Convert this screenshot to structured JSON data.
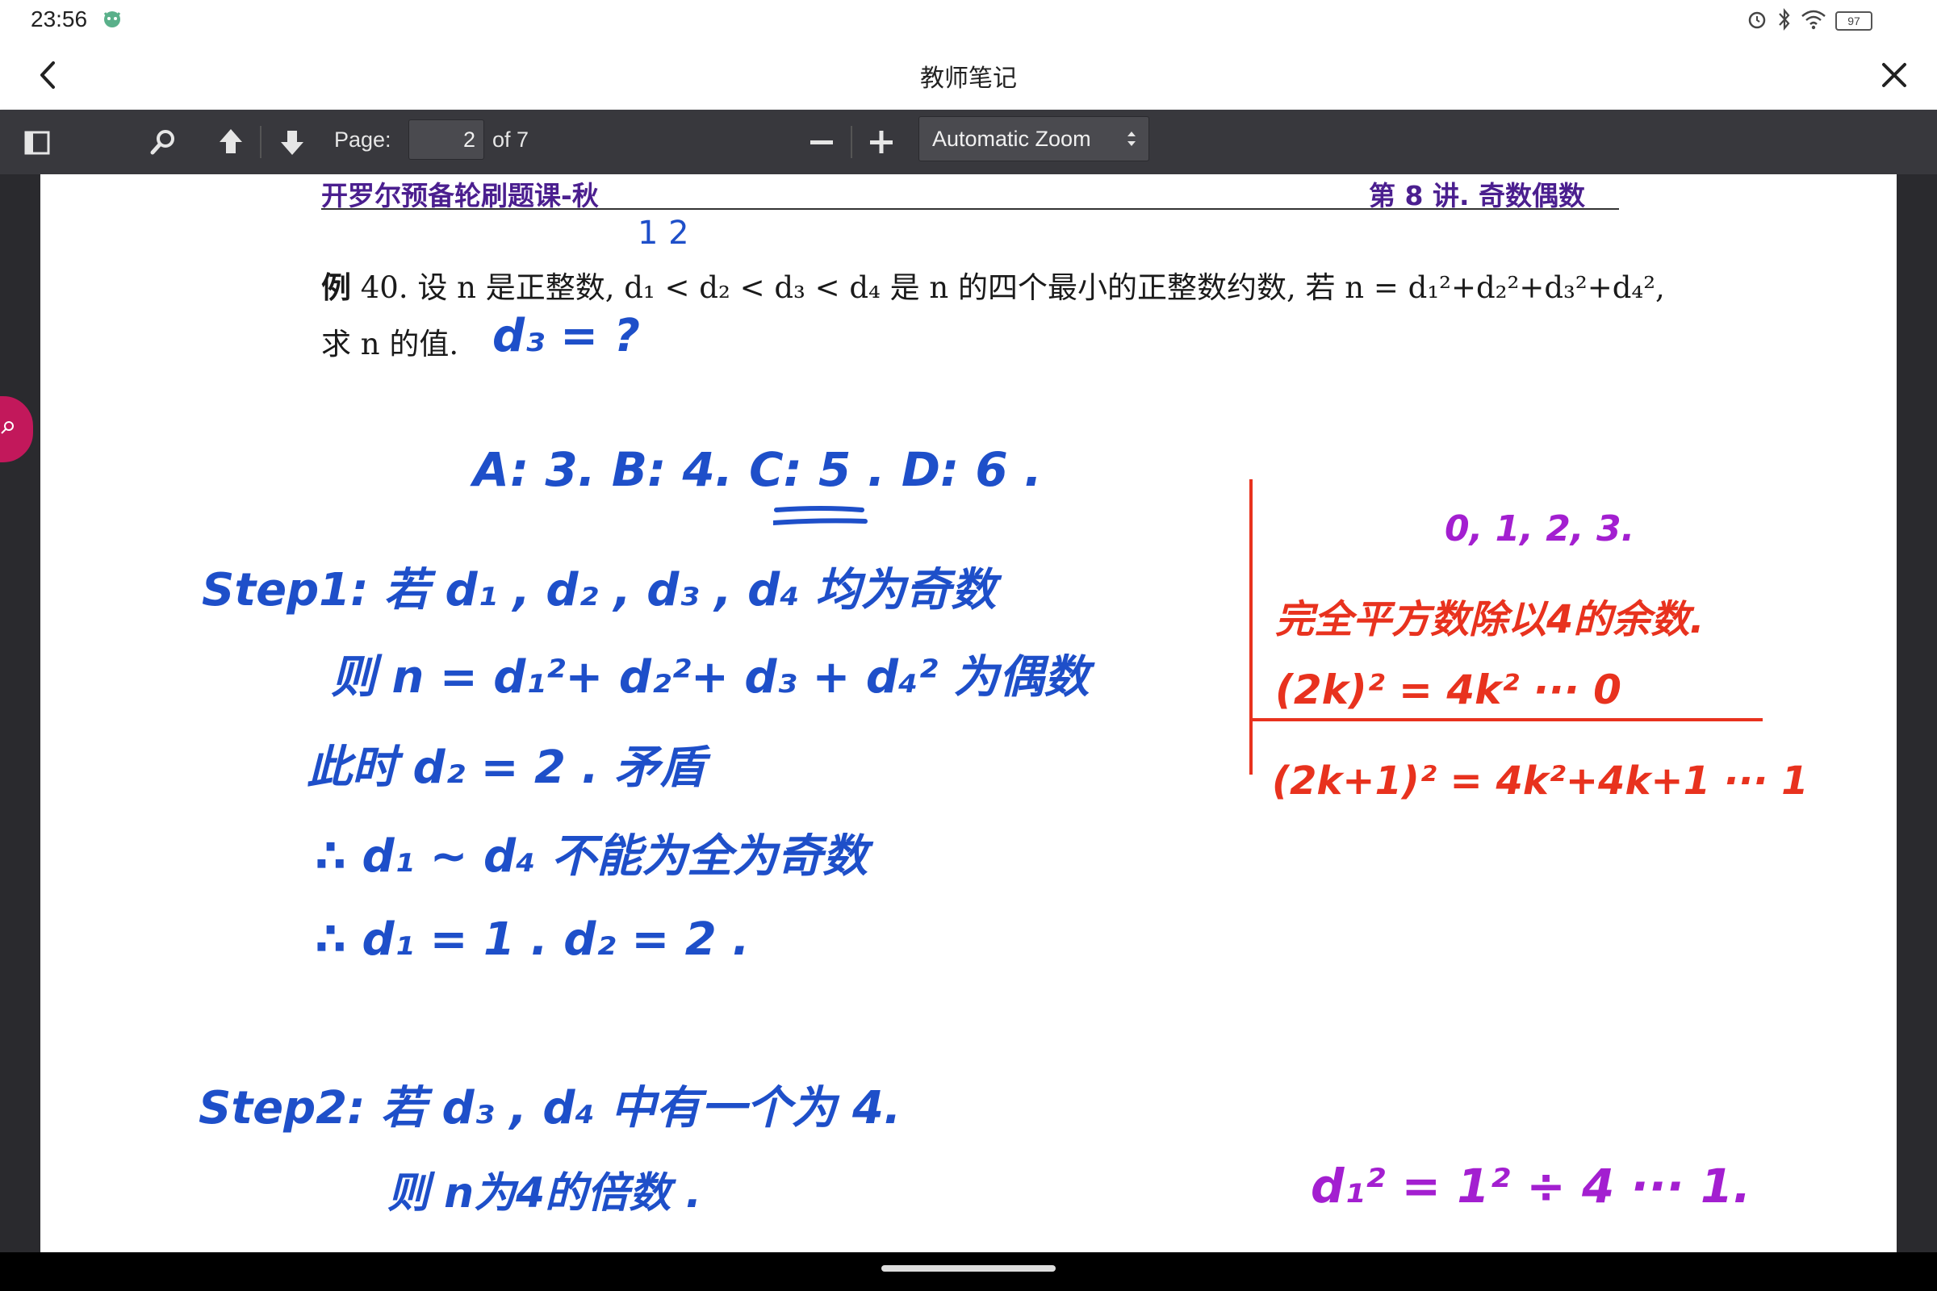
{
  "status": {
    "time": "23:56",
    "battery": "97",
    "icons": [
      "alarm-icon",
      "bluetooth-icon",
      "wifi-icon",
      "battery-icon"
    ]
  },
  "header": {
    "title": "教师笔记"
  },
  "toolbar": {
    "page_label": "Page:",
    "page_value": "2",
    "page_of": "of 7",
    "zoom_value": "Automatic Zoom"
  },
  "document": {
    "header_left": "开罗尔预备轮刷题课-秋",
    "header_right": "第 8 讲. 奇数偶数",
    "example_tag": "例",
    "problem_line1": "40. 设 n 是正整数, d₁ < d₂ < d₃ < d₄ 是 n 的四个最小的正整数约数, 若 n = d₁²+d₂²+d₃²+d₄²,",
    "problem_line2": "求 n 的值."
  },
  "handwriting": {
    "index_marks": "1   2",
    "question": "d₃ = ?",
    "options": "A: 3.  B: 4.  C: 5 . D: 6 .",
    "step1_a": "Step1: 若 d₁ , d₂ , d₃ , d₄ 均为奇数",
    "step1_b": "则 n = d₁²+ d₂²+ d₃ + d₄² 为偶数",
    "step1_c": "此时 d₂ = 2 . 矛盾",
    "step1_d": "∴ d₁ ~ d₄ 不能为全为奇数",
    "step1_e": "∴ d₁ = 1 . d₂ = 2 .",
    "step2_a": "Step2: 若 d₃ , d₄ 中有一个为 4.",
    "step2_b": "则 n为4的倍数 .",
    "red_remainders": "0, 1, 2, 3.",
    "red_title": "完全平方数除以4的余数.",
    "red_line1": "(2k)² = 4k² ··· 0",
    "red_line2": "(2k+1)² = 4k²+4k+1 ··· 1",
    "purple_line": "d₁² = 1² ÷ 4 ··· 1."
  },
  "colors": {
    "toolbar_bg": "#38383d",
    "viewer_bg": "#2a2a2e",
    "header_purple": "#4b1f8f",
    "ink_blue": "#1e4fc9",
    "ink_red": "#e8321e",
    "ink_purple": "#a31fd0",
    "sidebar_tab": "#c2185b"
  }
}
